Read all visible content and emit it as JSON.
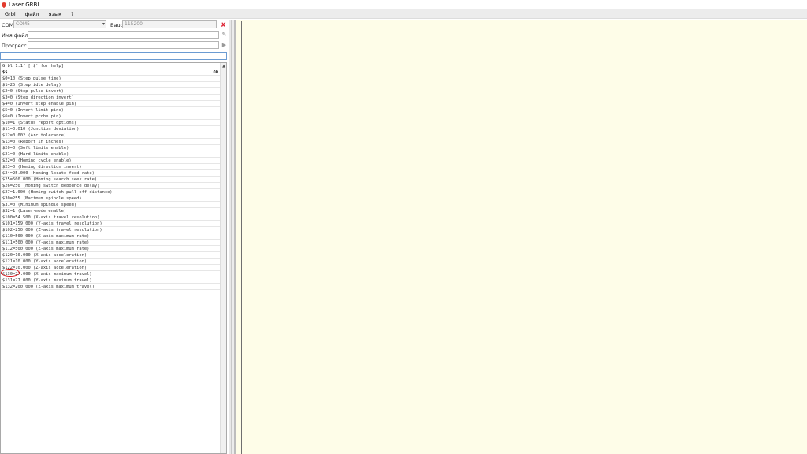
{
  "window": {
    "title": "Laser GRBL"
  },
  "menu": [
    "Grbl",
    "файл",
    "язык",
    "?"
  ],
  "com": {
    "label": "COM",
    "value": "COM5",
    "baud_label": "Baud",
    "baud_value": "115200"
  },
  "file": {
    "label": "Имя файла",
    "value": ""
  },
  "progress": {
    "label": "Прогресс",
    "value": ""
  },
  "command_input": {
    "value": ""
  },
  "console": {
    "lines": [
      {
        "text": "Grbl 1.1f ['$' for help]",
        "ok": ""
      },
      {
        "text": "$$",
        "ok": "OK",
        "cmd": true
      },
      {
        "text": "$0=10 (Step pulse time)",
        "ok": ""
      },
      {
        "text": "$1=25 (Step idle delay)",
        "ok": ""
      },
      {
        "text": "$2=0 (Step pulse invert)",
        "ok": ""
      },
      {
        "text": "$3=0 (Step direction invert)",
        "ok": ""
      },
      {
        "text": "$4=0 (Invert step enable pin)",
        "ok": ""
      },
      {
        "text": "$5=0 (Invert limit pins)",
        "ok": ""
      },
      {
        "text": "$6=0 (Invert probe pin)",
        "ok": ""
      },
      {
        "text": "$10=1 (Status report options)",
        "ok": ""
      },
      {
        "text": "$11=0.010 (Junction deviation)",
        "ok": ""
      },
      {
        "text": "$12=0.002 (Arc tolerance)",
        "ok": ""
      },
      {
        "text": "$13=0 (Report in inches)",
        "ok": ""
      },
      {
        "text": "$20=0 (Soft limits enable)",
        "ok": ""
      },
      {
        "text": "$21=0 (Hard limits enable)",
        "ok": ""
      },
      {
        "text": "$22=0 (Homing cycle enable)",
        "ok": ""
      },
      {
        "text": "$23=0 (Homing direction invert)",
        "ok": ""
      },
      {
        "text": "$24=25.000 (Homing locate feed rate)",
        "ok": ""
      },
      {
        "text": "$25=500.000 (Homing search seek rate)",
        "ok": ""
      },
      {
        "text": "$26=250 (Homing switch debounce delay)",
        "ok": ""
      },
      {
        "text": "$27=1.000 (Homing switch pull-off distance)",
        "ok": ""
      },
      {
        "text": "$30=255 (Maximum spindle speed)",
        "ok": ""
      },
      {
        "text": "$31=0 (Minimum spindle speed)",
        "ok": ""
      },
      {
        "text": "$32=1 (Laser-mode enable)",
        "ok": ""
      },
      {
        "text": "$100=54.500 (X-axis travel resolution)",
        "ok": ""
      },
      {
        "text": "$101=159.000 (Y-axis travel resolution)",
        "ok": ""
      },
      {
        "text": "$102=250.000 (Z-axis travel resolution)",
        "ok": ""
      },
      {
        "text": "$110=500.000 (X-axis maximum rate)",
        "ok": ""
      },
      {
        "text": "$111=500.000 (Y-axis maximum rate)",
        "ok": ""
      },
      {
        "text": "$112=500.000 (Z-axis maximum rate)",
        "ok": ""
      },
      {
        "text": "$120=10.000 (X-axis acceleration)",
        "ok": ""
      },
      {
        "text": "$121=10.000 (Y-axis acceleration)",
        "ok": ""
      },
      {
        "text": "$122=10.000 (Z-axis acceleration)",
        "ok": ""
      },
      {
        "text": "$130=27.000 (X-axis maximum travel)",
        "ok": ""
      },
      {
        "text": "$131=27.000 (Y-axis maximum travel)",
        "ok": ""
      },
      {
        "text": "$132=200.000 (Z-axis maximum travel)",
        "ok": ""
      }
    ]
  },
  "colors": {
    "canvas_bg": "#fefde8",
    "highlight": "#d8141a"
  }
}
